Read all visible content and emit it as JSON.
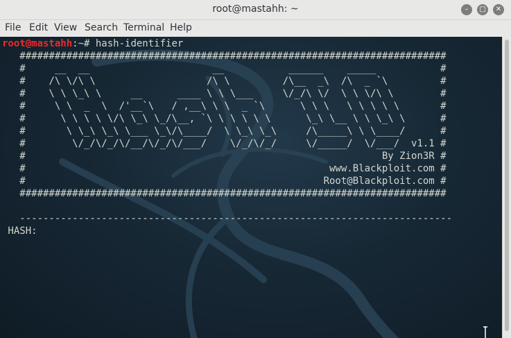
{
  "window": {
    "title": "root@mastahh: ~",
    "controls": {
      "minimize": "minimize-icon",
      "maximize": "maximize-icon",
      "close": "close-icon"
    }
  },
  "menubar": {
    "items": [
      {
        "label": "File"
      },
      {
        "label": "Edit"
      },
      {
        "label": "View"
      },
      {
        "label": "Search"
      },
      {
        "label": "Terminal"
      },
      {
        "label": "Help"
      }
    ]
  },
  "terminal": {
    "prompt_user": "root@mastahh",
    "prompt_path": ":~# ",
    "command": "hash-identifier",
    "banner_lines": [
      "   #########################################################################",
      "   #     __  __                     __           ______    _____           #",
      "   #    /\\ \\/\\ \\                   /\\ \\         /\\__  _\\  /\\  _ `\\         #",
      "   #    \\ \\ \\_\\ \\     __      ____ \\ \\ \\___     \\/_/\\ \\/  \\ \\ \\/\\ \\        #",
      "   #     \\ \\  _  \\  /'__`\\   / ,__\\ \\ \\  _ `\\      \\ \\ \\   \\ \\ \\ \\ \\       #",
      "   #      \\ \\ \\ \\ \\/\\ \\_\\ \\_/\\__, `\\ \\ \\ \\ \\ \\      \\_\\ \\__ \\ \\ \\_\\ \\      #",
      "   #       \\ \\_\\ \\_\\ \\___ \\_\\/\\____/  \\ \\_\\ \\_\\     /\\_____\\ \\ \\____/      #",
      "   #        \\/_/\\/_/\\/__/\\/_/\\/___/    \\/_/\\/_/     \\/_____/  \\/___/  v1.1 #",
      "   #                                                             By Zion3R #",
      "   #                                                    www.Blackploit.com #",
      "   #                                                   Root@Blackploit.com #",
      "   #########################################################################"
    ],
    "separator": "   --------------------------------------------------------------------------",
    "input_label": " HASH:"
  },
  "colors": {
    "prompt_user": "#ef2929",
    "terminal_text": "#d3d7cf",
    "terminal_background": "#172835"
  }
}
